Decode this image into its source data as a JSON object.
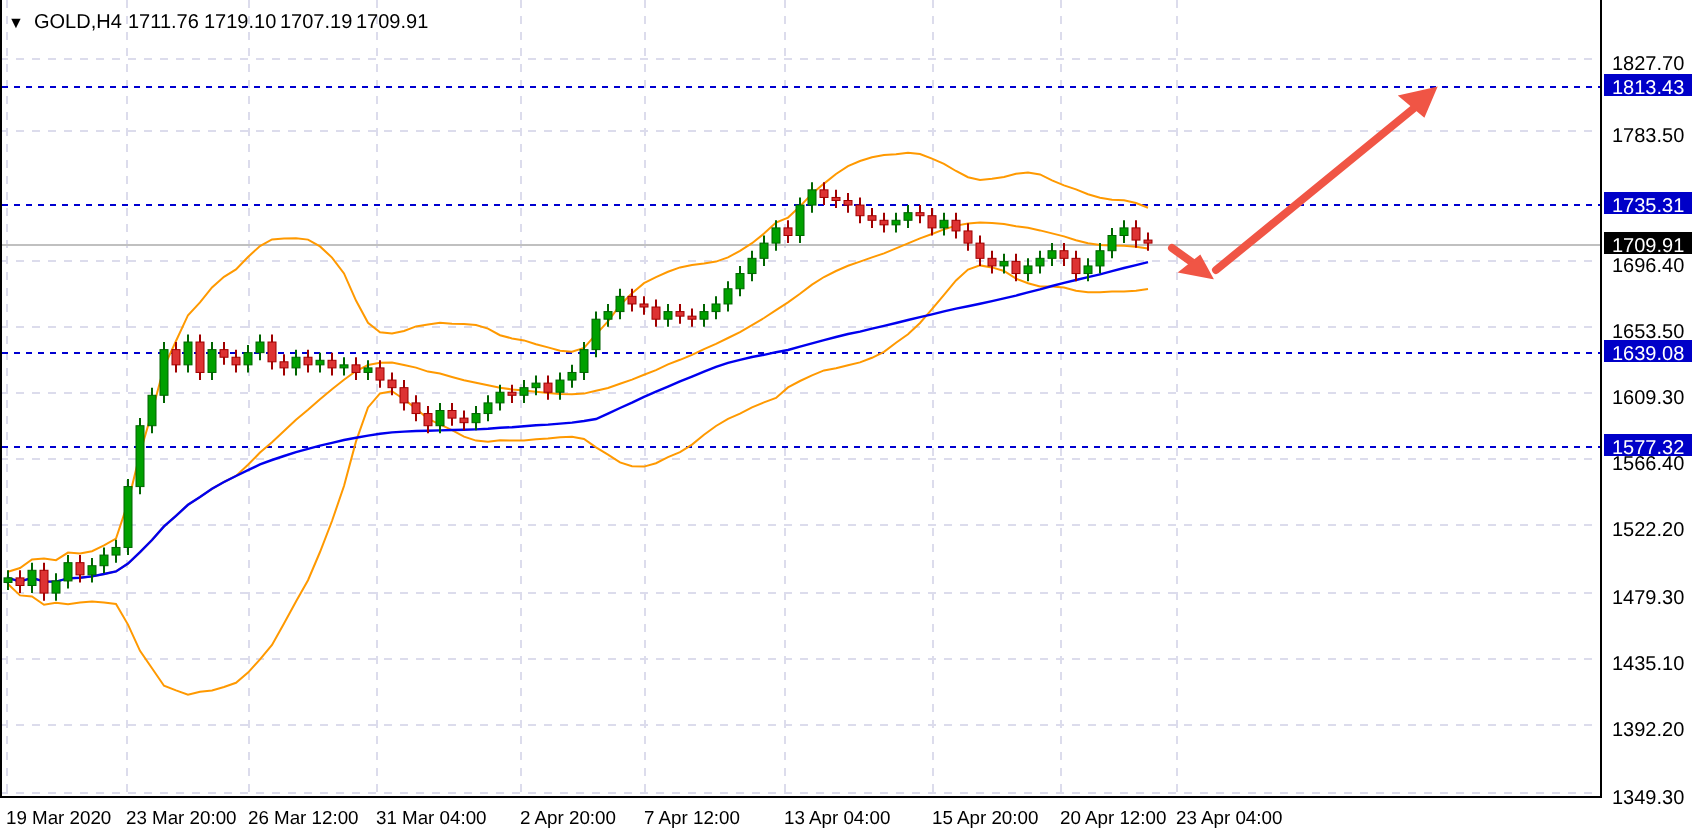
{
  "chart": {
    "header_marker": "▼",
    "symbol": "GOLD,H4",
    "ohlc": [
      "1711.76",
      "1719.10",
      "1707.19",
      "1709.91"
    ],
    "levels": [
      {
        "label": "1813.43"
      },
      {
        "label": "1735.31"
      },
      {
        "label": "1639.08"
      },
      {
        "label": "1577.32"
      }
    ],
    "current_price": {
      "label": "1709.91"
    },
    "price_axis_labels": [
      "1827.70",
      "1783.50",
      "1696.40",
      "1653.50",
      "1609.30",
      "1566.40",
      "1522.20",
      "1479.30",
      "1435.10",
      "1392.20",
      "1349.30"
    ],
    "time_axis_labels": [
      "19 Mar 2020",
      "23 Mar 20:00",
      "26 Mar 12:00",
      "31 Mar 04:00",
      "2 Apr 20:00",
      "7 Apr 12:00",
      "13 Apr 04:00",
      "15 Apr 20:00",
      "20 Apr 12:00",
      "23 Apr 04:00"
    ]
  }
}
